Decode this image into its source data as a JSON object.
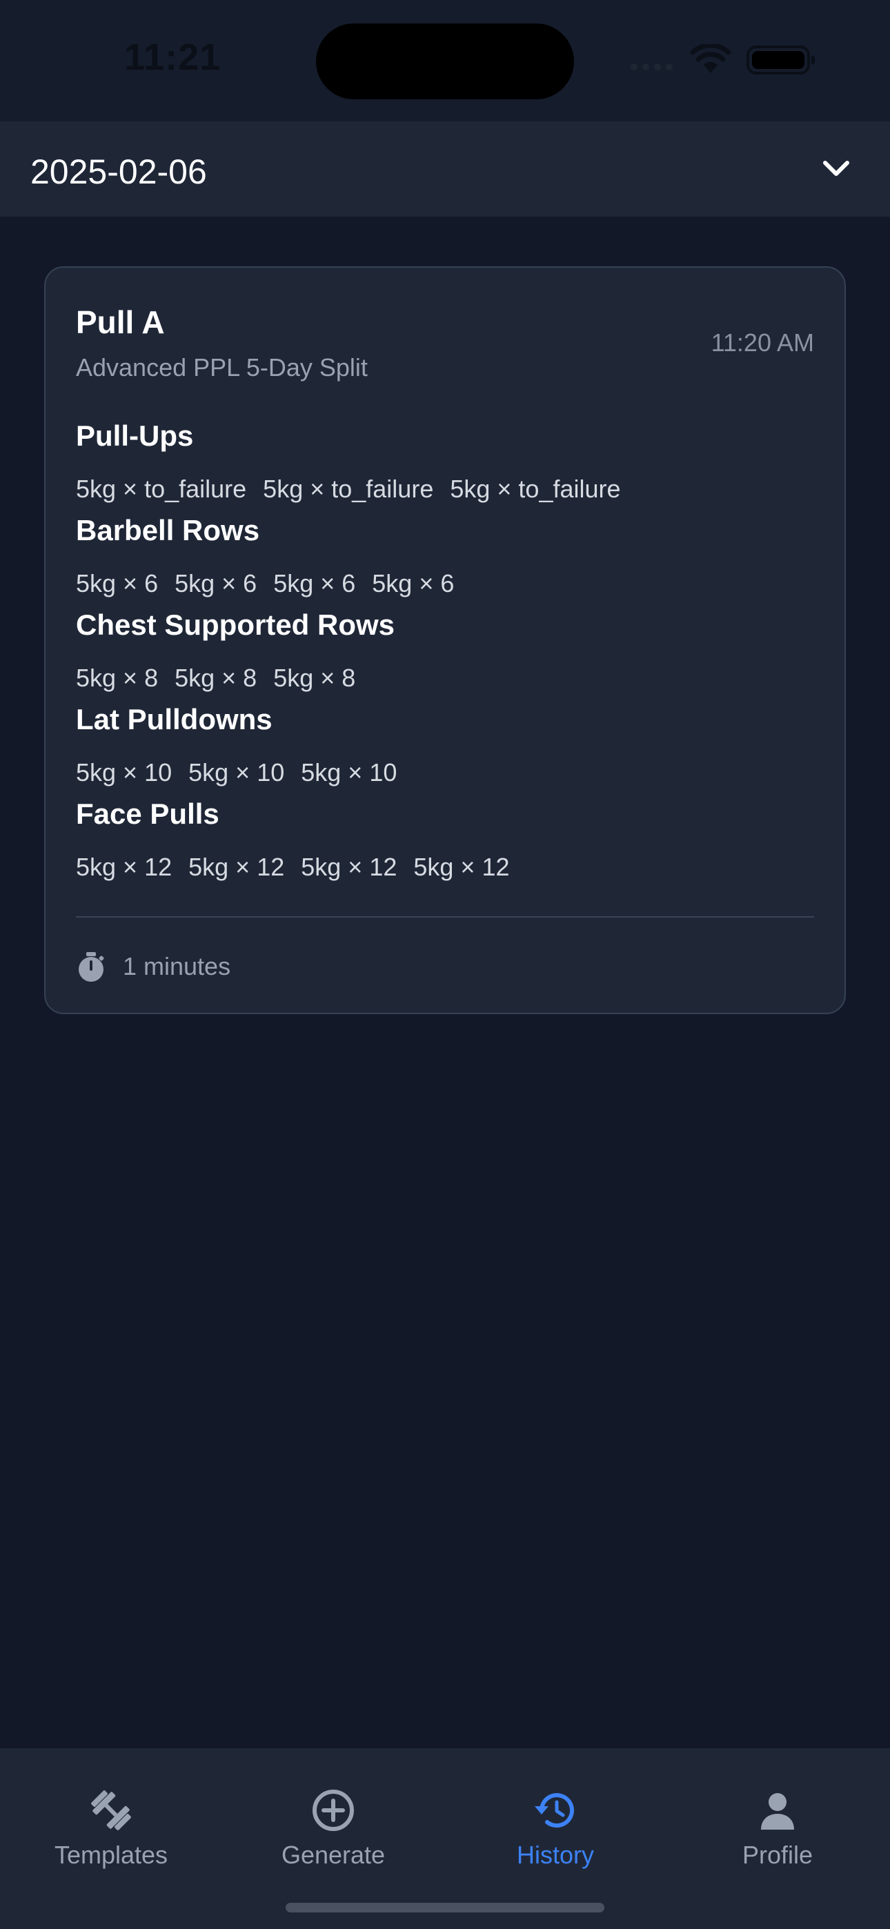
{
  "status_bar": {
    "time": "11:21"
  },
  "date_selector": {
    "value": "2025-02-06"
  },
  "workout": {
    "title": "Pull A",
    "subtitle": "Advanced PPL 5-Day Split",
    "time": "11:20 AM",
    "exercises": [
      {
        "name": "Pull-Ups",
        "sets": [
          "5kg × to_failure",
          "5kg × to_failure",
          "5kg × to_failure"
        ]
      },
      {
        "name": "Barbell Rows",
        "sets": [
          "5kg × 6",
          "5kg × 6",
          "5kg × 6",
          "5kg × 6"
        ]
      },
      {
        "name": "Chest Supported Rows",
        "sets": [
          "5kg × 8",
          "5kg × 8",
          "5kg × 8"
        ]
      },
      {
        "name": "Lat Pulldowns",
        "sets": [
          "5kg × 10",
          "5kg × 10",
          "5kg × 10"
        ]
      },
      {
        "name": "Face Pulls",
        "sets": [
          "5kg × 12",
          "5kg × 12",
          "5kg × 12",
          "5kg × 12"
        ]
      }
    ],
    "duration": "1 minutes"
  },
  "tabs": [
    {
      "label": "Templates",
      "icon": "dumbbell-icon",
      "active": false
    },
    {
      "label": "Generate",
      "icon": "plus-circle-icon",
      "active": false
    },
    {
      "label": "History",
      "icon": "history-icon",
      "active": true
    },
    {
      "label": "Profile",
      "icon": "person-icon",
      "active": false
    }
  ],
  "colors": {
    "background": "#121827",
    "surface": "#1f2737",
    "accent": "#3d82f6",
    "muted": "#9aa2b1"
  }
}
